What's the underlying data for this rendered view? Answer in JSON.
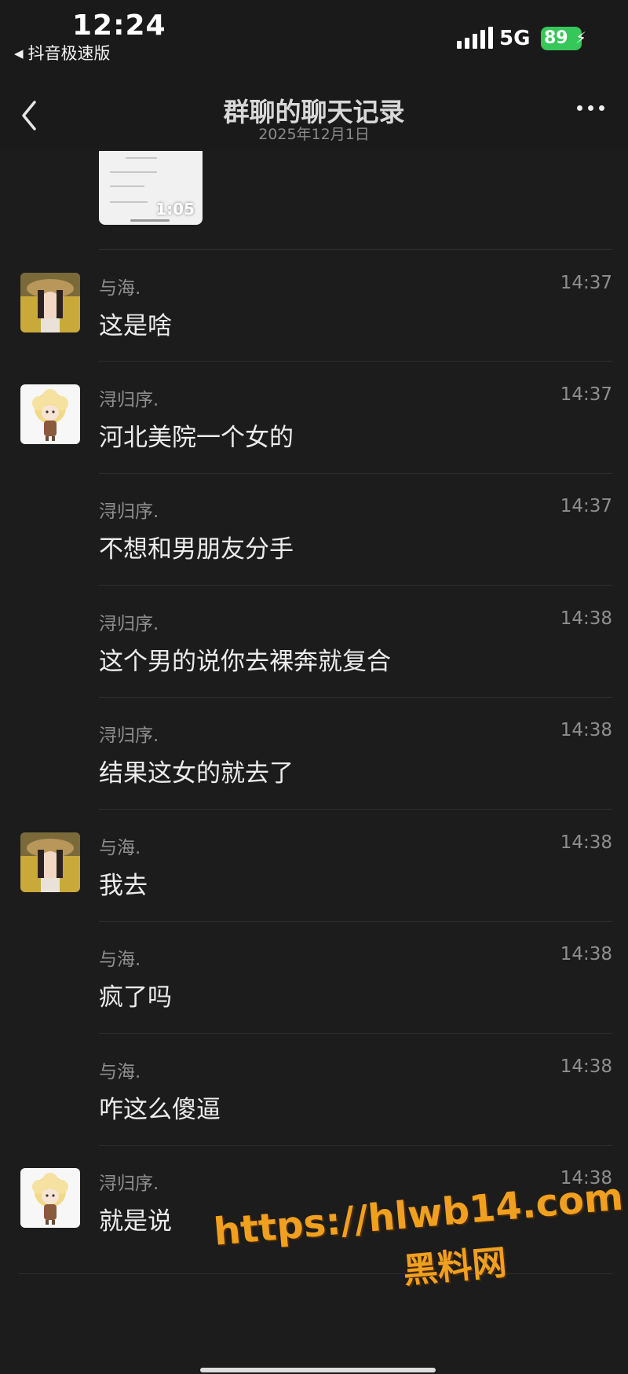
{
  "status_bar": {
    "time": "12:24",
    "back_app": "抖音极速版",
    "network": "5G",
    "battery": "89"
  },
  "nav": {
    "title": "群聊的聊天记录",
    "subtitle": "2025年12月1日"
  },
  "thumbnail": {
    "duration": "1:05"
  },
  "messages": [
    {
      "sender": "与海.",
      "time": "14:37",
      "text": "这是啥",
      "avatar": "photo-avatar"
    },
    {
      "sender": "浔归序.",
      "time": "14:37",
      "text": "河北美院一个女的",
      "avatar": "cartoon-avatar"
    },
    {
      "sender": "浔归序.",
      "time": "14:37",
      "text": "不想和男朋友分手",
      "avatar": ""
    },
    {
      "sender": "浔归序.",
      "time": "14:38",
      "text": "这个男的说你去裸奔就复合",
      "avatar": ""
    },
    {
      "sender": "浔归序.",
      "time": "14:38",
      "text": "结果这女的就去了",
      "avatar": ""
    },
    {
      "sender": "与海.",
      "time": "14:38",
      "text": "我去",
      "avatar": "photo-avatar"
    },
    {
      "sender": "与海.",
      "time": "14:38",
      "text": "疯了吗",
      "avatar": ""
    },
    {
      "sender": "与海.",
      "time": "14:38",
      "text": "咋这么傻逼",
      "avatar": ""
    },
    {
      "sender": "浔归序.",
      "time": "14:38",
      "text": "就是说",
      "avatar": "cartoon-avatar"
    }
  ],
  "watermark": {
    "url": "https://hlwb14.com",
    "name": "黑料网"
  },
  "colors": {
    "background": "#1c1c1c",
    "battery": "#35c759",
    "watermark": "#f0a020"
  }
}
